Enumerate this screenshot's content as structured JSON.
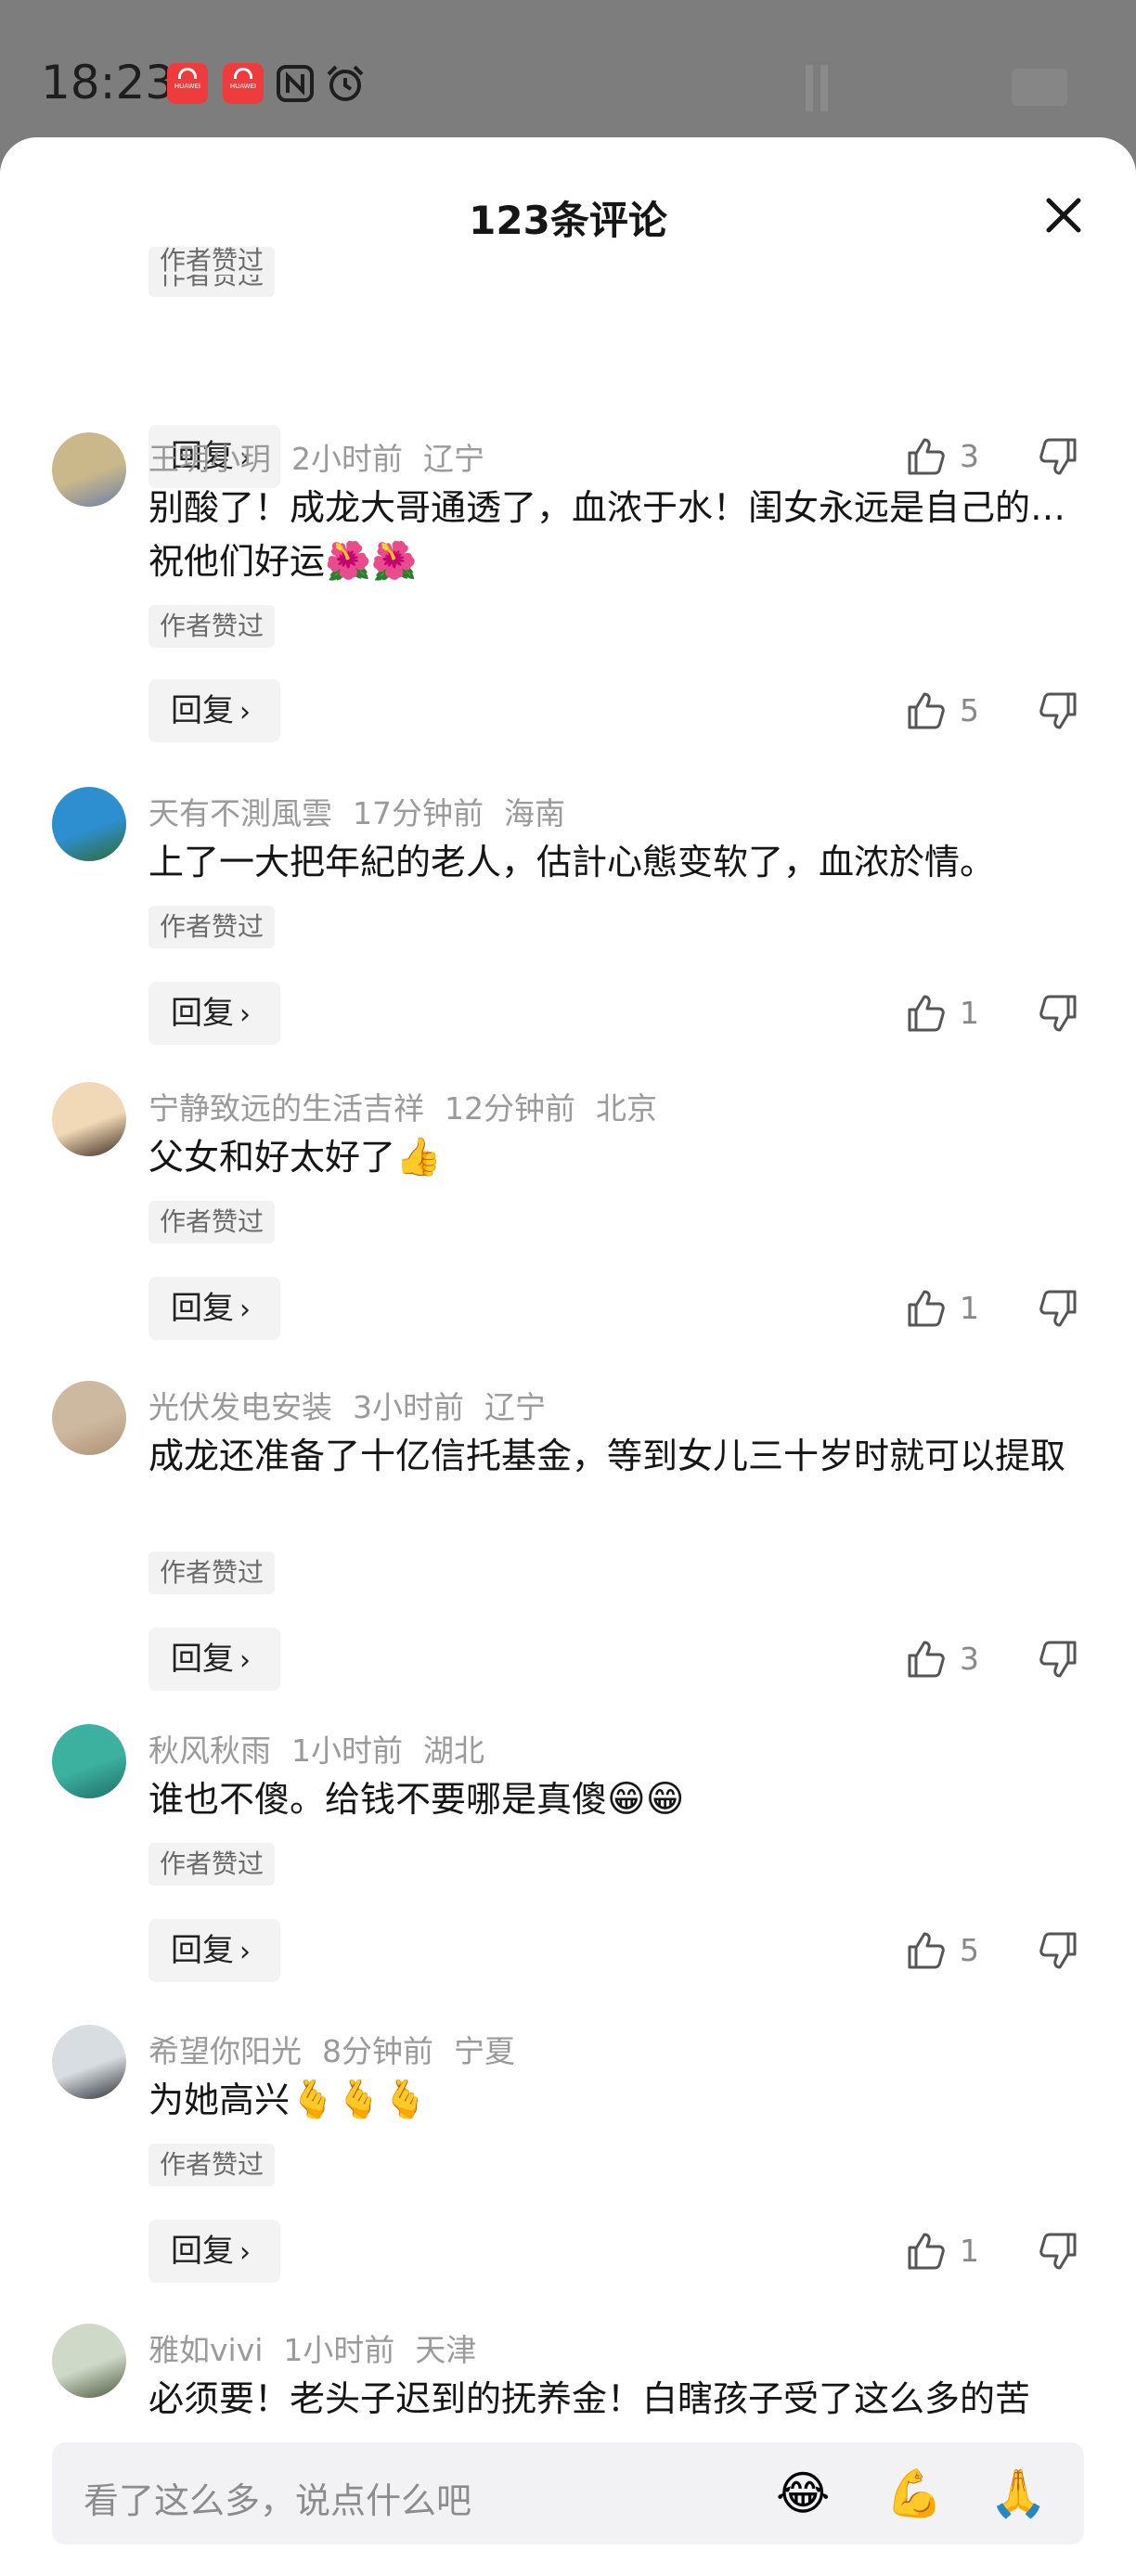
{
  "status_bar": {
    "time": "18:23",
    "icons": [
      "huawei-app-icon",
      "huawei-app-icon",
      "nfc-icon",
      "alarm-icon"
    ]
  },
  "sheet": {
    "title": "123条评论",
    "close_icon": "close-icon"
  },
  "partial_comment": {
    "badge": "作者赞过",
    "reply": "回复",
    "likes": "3"
  },
  "comments": [
    {
      "user": "王玥小玥",
      "time": "2小时前",
      "location": "辽宁",
      "text": "别酸了！成龙大哥通透了，血浓于水！闺女永远是自己的… 祝他们好运",
      "emoji": "🌺🌺",
      "badge": "作者赞过",
      "reply": "回复",
      "likes": "5"
    },
    {
      "user": "天有不測風雲",
      "time": "17分钟前",
      "location": "海南",
      "text": "上了一大把年紀的老人，估計心態变软了，血浓於情。",
      "emoji": "",
      "badge": "作者赞过",
      "reply": "回复",
      "likes": "1"
    },
    {
      "user": "宁静致远的生活吉祥",
      "time": "12分钟前",
      "location": "北京",
      "text": "父女和好太好了",
      "emoji": "👍",
      "badge": "作者赞过",
      "reply": "回复",
      "likes": "1"
    },
    {
      "user": "光伏发电安装",
      "time": "3小时前",
      "location": "辽宁",
      "text": "成龙还准备了十亿信托基金，等到女儿三十岁时就可以提取",
      "emoji": "",
      "badge": "作者赞过",
      "reply": "回复",
      "likes": "3"
    },
    {
      "user": "秋风秋雨",
      "time": "1小时前",
      "location": "湖北",
      "text": "谁也不傻。给钱不要哪是真傻",
      "emoji": "😁😁",
      "badge": "作者赞过",
      "reply": "回复",
      "likes": "5"
    },
    {
      "user": "希望你阳光",
      "time": "8分钟前",
      "location": "宁夏",
      "text": "为她高兴",
      "emoji": "🫰🫰🫰",
      "badge": "作者赞过",
      "reply": "回复",
      "likes": "1"
    },
    {
      "user": "雅如vivi",
      "time": "1小时前",
      "location": "天津",
      "text": "必须要！老头子迟到的抚养金！白瞎孩子受了这么多的苦",
      "emoji": ""
    }
  ],
  "input_bar": {
    "placeholder": "看了这么多，说点什么吧",
    "emojis": [
      "😂",
      "💪",
      "🙏"
    ]
  },
  "colors": {
    "accent_text": "#151515",
    "meta_text": "#9a9a9a",
    "status_bar_bg": "#7d7d7d"
  }
}
